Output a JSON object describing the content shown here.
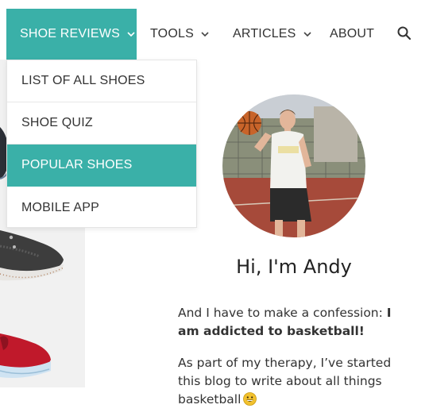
{
  "nav": {
    "items": [
      {
        "label": "SHOE REVIEWS",
        "active": true,
        "has_dropdown": true
      },
      {
        "label": "TOOLS",
        "active": false,
        "has_dropdown": true
      },
      {
        "label": "ARTICLES",
        "active": false,
        "has_dropdown": true
      },
      {
        "label": "ABOUT",
        "active": false,
        "has_dropdown": false
      }
    ],
    "search_icon": "search-icon"
  },
  "dropdown": {
    "items": [
      {
        "label": "LIST OF ALL SHOES"
      },
      {
        "label": "SHOE QUIZ"
      },
      {
        "label": "POPULAR SHOES",
        "highlighted": true
      },
      {
        "label": "MOBILE APP"
      }
    ]
  },
  "profile": {
    "greeting": "Hi, I'm Andy",
    "intro_plain": "And I have to make a confession: ",
    "intro_bold": "I am addicted to basketball!",
    "therapy_text": "As part of my therapy, I’ve started this blog to write about all things basketball",
    "emoji": "grinning-face-emoji"
  },
  "colors": {
    "accent": "#3ab0a8",
    "text": "#333333"
  }
}
